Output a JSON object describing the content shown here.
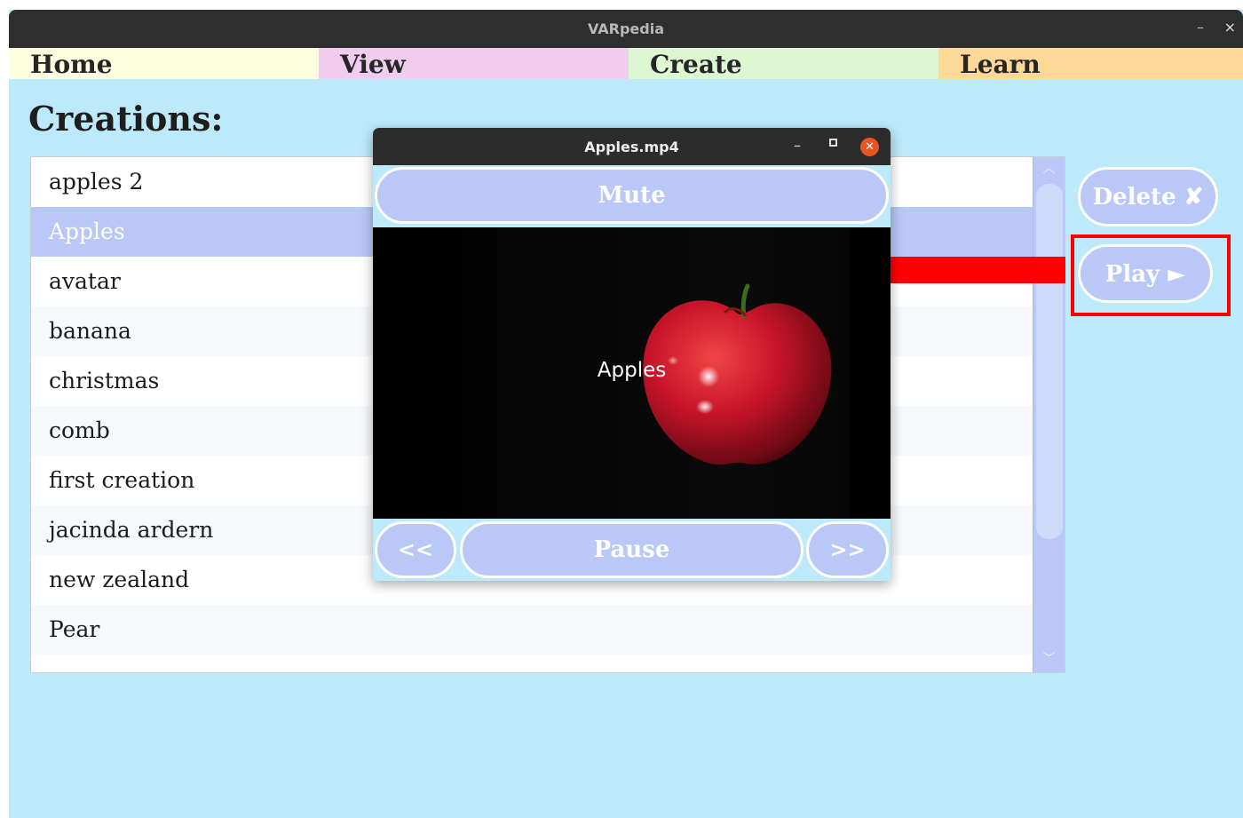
{
  "window": {
    "title": "VARpedia",
    "minimize": "–",
    "close": "×"
  },
  "tabs": [
    {
      "label": "Home"
    },
    {
      "label": "View"
    },
    {
      "label": "Create"
    },
    {
      "label": "Learn"
    }
  ],
  "heading": "Creations:",
  "creations": [
    "apples 2",
    "Apples",
    "avatar",
    "banana",
    "christmas",
    "comb",
    "first creation",
    "jacinda ardern",
    "new zealand",
    "Pear"
  ],
  "selected_index": 1,
  "scrollbar": {
    "up": "︿",
    "down": "﹀"
  },
  "actions": {
    "delete_label": "Delete ✘",
    "play_label": "Play ►"
  },
  "player": {
    "title": "Apples.mp4",
    "minimize": "–",
    "close": "✕",
    "mute_label": "Mute",
    "subtitle": "Apples",
    "rewind_label": "<<",
    "pause_label": "Pause",
    "forward_label": ">>"
  },
  "colors": {
    "background": "#bdeafb",
    "button": "#b9c8f7",
    "selected_row": "#b9c8f7",
    "annotation": "#ff0000"
  }
}
